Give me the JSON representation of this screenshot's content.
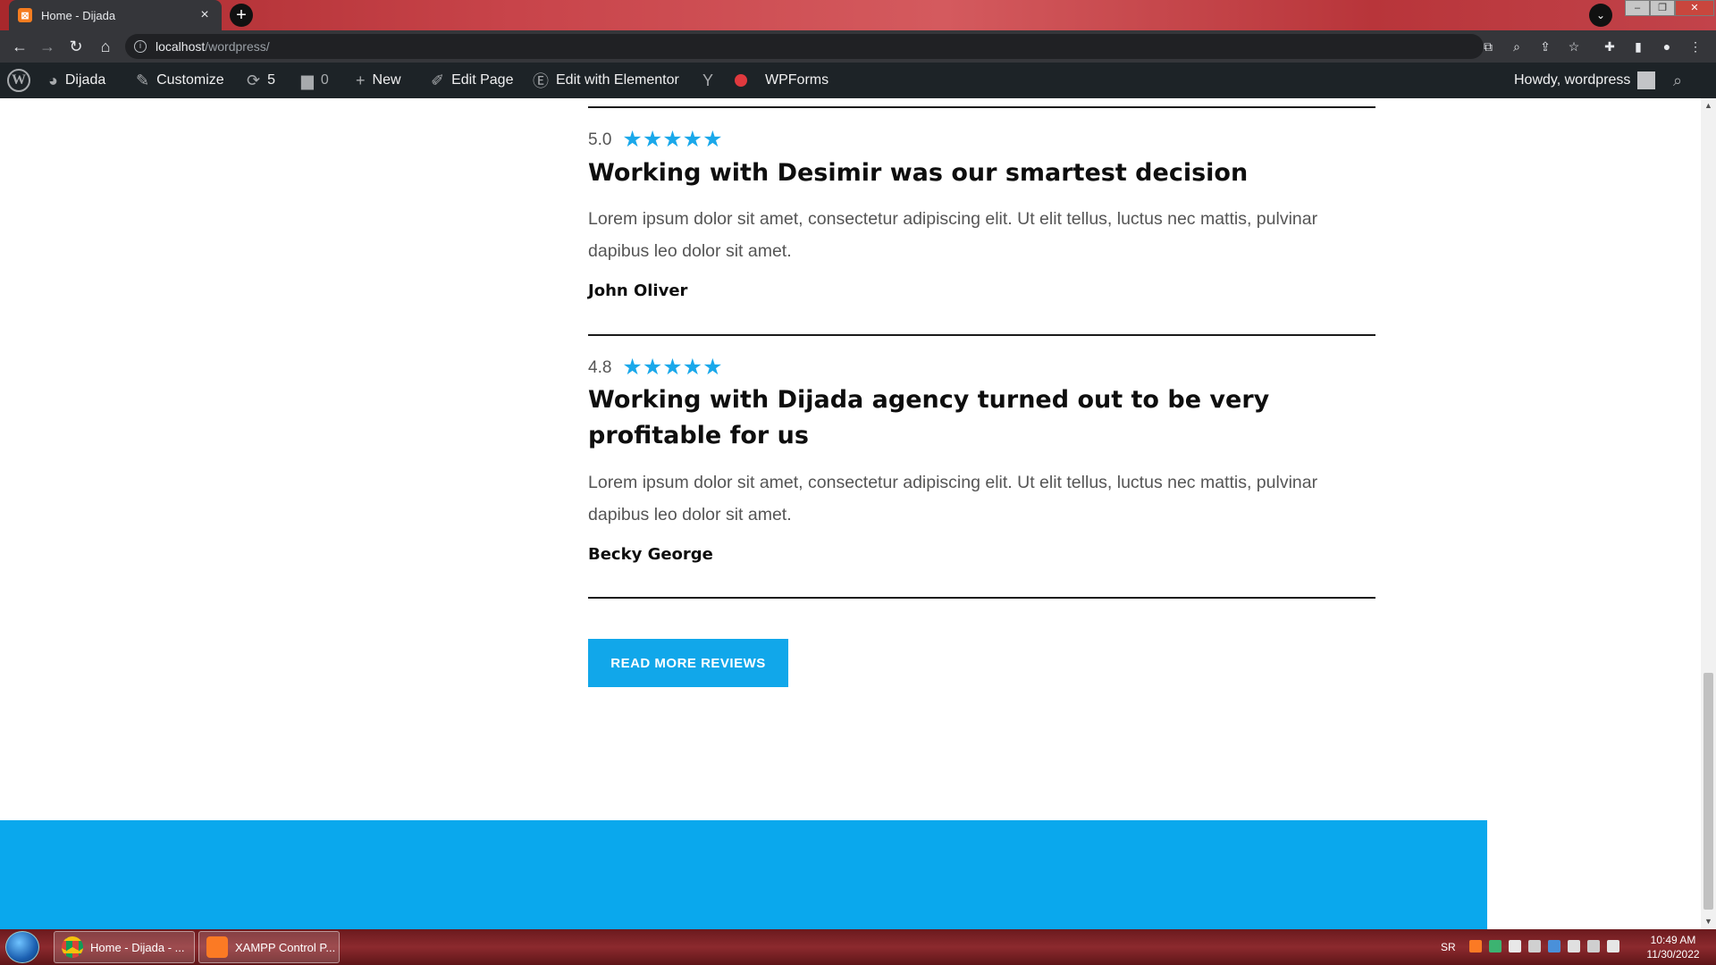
{
  "browser": {
    "tab_title": "Home - Dijada",
    "tab_close": "×",
    "new_tab": "+",
    "url_host": "localhost",
    "url_path": "/wordpress/"
  },
  "admin_bar": {
    "site_name": "Dijada",
    "customize": "Customize",
    "updates_count": "5",
    "comments_count": "0",
    "new": "New",
    "edit_page": "Edit Page",
    "edit_elementor": "Edit with Elementor",
    "wpforms": "WPForms",
    "howdy": "Howdy, wordpress"
  },
  "reviews": [
    {
      "rating": "5.0",
      "stars": "★★★★★",
      "title": "Working with Desimir was our smartest decision",
      "text": "Lorem ipsum dolor sit amet, consectetur adipiscing elit. Ut elit tellus, luctus nec mattis, pulvinar dapibus leo dolor sit amet.",
      "author": "John Oliver"
    },
    {
      "rating": "4.8",
      "stars": "★★★★★",
      "title": "Working with Dijada agency turned out to be very profitable for us",
      "text": "Lorem ipsum dolor sit amet, consectetur adipiscing elit. Ut elit tellus, luctus nec mattis, pulvinar dapibus leo dolor sit amet.",
      "author": "Becky George"
    }
  ],
  "read_more_label": "READ MORE REVIEWS",
  "colors": {
    "accent": "#11a7ea",
    "footer_band": "#0aa8ed",
    "admin_bar": "#1d2327"
  },
  "taskbar": {
    "chrome_task": "Home - Dijada - ...",
    "xampp_task": "XAMPP Control P...",
    "lang": "SR",
    "time": "10:49 AM",
    "date": "11/30/2022"
  }
}
